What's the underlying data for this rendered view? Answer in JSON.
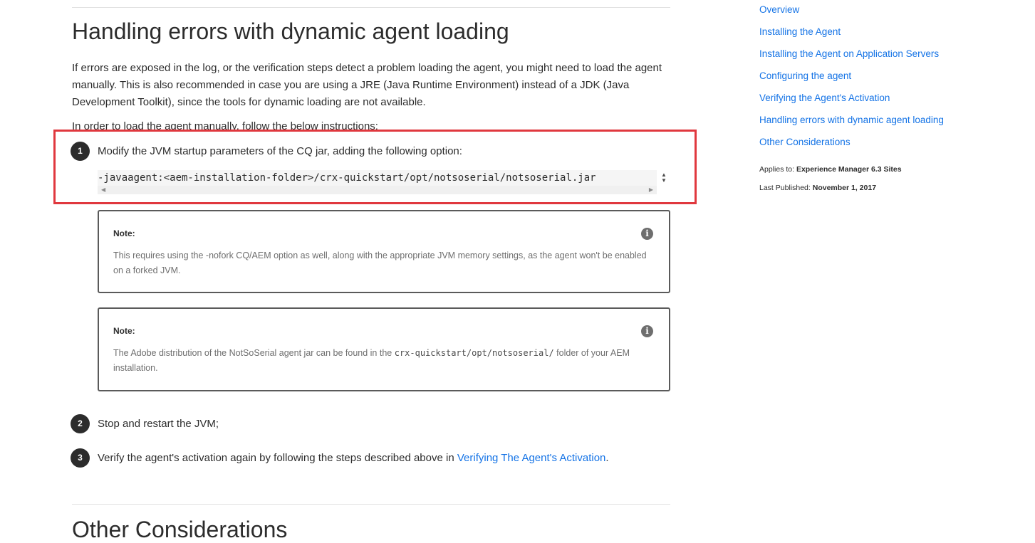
{
  "main": {
    "heading": "Handling errors with dynamic agent loading",
    "paragraph1": "If errors are exposed in the log, or the verification steps detect a problem loading the agent, you might need to load the agent manually. This is also recommended in case you are using a JRE (Java Runtime Environment) instead of a JDK (Java Development Toolkit), since the tools for dynamic loading are not available.",
    "paragraph2": "In order to load the agent manually, follow the below instructions:",
    "steps": [
      {
        "number": "1",
        "text": "Modify the JVM startup parameters of the CQ jar, adding the following option:",
        "code": "-javaagent:<aem-installation-folder>/crx-quickstart/opt/notsoserial/notsoserial.jar"
      },
      {
        "number": "2",
        "text": "Stop and restart the JVM;"
      },
      {
        "number": "3",
        "text_before": "Verify the agent's activation again by following the steps described above in ",
        "link": "Verifying The Agent's Activation",
        "text_after": "."
      }
    ],
    "notes": [
      {
        "title": "Note:",
        "body": "This requires using the -nofork CQ/AEM option as well, along with the appropriate JVM memory settings, as the agent won't be enabled on a forked JVM."
      },
      {
        "title": "Note:",
        "body_before": "The Adobe distribution of the NotSoSerial agent jar can be found in the ",
        "body_code": "crx-quickstart/opt/notsoserial/",
        "body_after": " folder of your AEM installation."
      }
    ],
    "next_heading": "Other Considerations"
  },
  "toc": {
    "items": [
      "Overview",
      "Installing the Agent",
      "Installing the Agent on Application Servers",
      "Configuring the agent",
      "Verifying the Agent's Activation",
      "Handling errors with dynamic agent loading",
      "Other Considerations"
    ],
    "applies_label": "Applies to:",
    "applies_value": "Experience Manager 6.3 Sites",
    "published_label": "Last Published:",
    "published_value": "November 1, 2017"
  },
  "colors": {
    "link": "#1473e6",
    "highlight": "#e0383e",
    "text": "#2c2c2c"
  },
  "icons": {
    "note": "info-icon",
    "scroll_left": "scroll-left-arrow-icon",
    "scroll_right": "scroll-right-arrow-icon"
  }
}
